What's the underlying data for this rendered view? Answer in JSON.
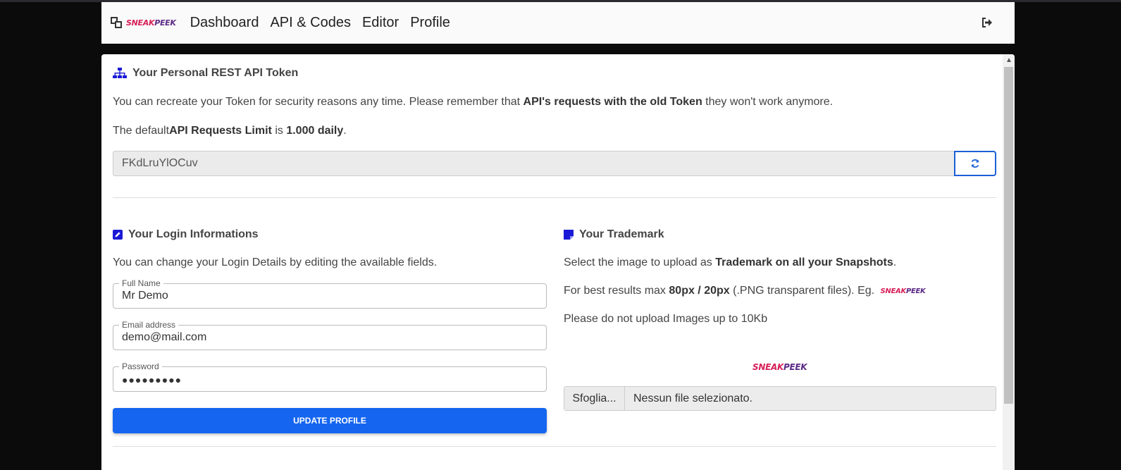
{
  "navbar": {
    "brand_part1": "SNEAK",
    "brand_part2": "PEEK",
    "links": [
      "Dashboard",
      "API & Codes",
      "Editor",
      "Profile"
    ],
    "logout_icon": "sign-out-icon"
  },
  "token_section": {
    "title": "Your Personal REST API Token",
    "desc_pre": "You can recreate your Token for security reasons any time. Please remember that ",
    "desc_bold": "API's requests with the old Token",
    "desc_post": " they won't work anymore.",
    "limit_pre": "The default",
    "limit_bold1": "API Requests Limit",
    "limit_mid": " is ",
    "limit_bold2": "1.000 daily",
    "limit_post": ".",
    "token_value": "FKdLruYlOCuv",
    "refresh_icon": "refresh-icon"
  },
  "login_section": {
    "title": "Your Login Informations",
    "desc": "You can change your Login Details by editing the available fields.",
    "full_name_label": "Full Name",
    "full_name_value": "Mr Demo",
    "email_label": "Email address",
    "email_value": "demo@mail.com",
    "password_label": "Password",
    "password_value": "●●●●●●●●●",
    "update_button": "UPDATE PROFILE"
  },
  "trademark_section": {
    "title": "Your Trademark",
    "desc_pre": "Select the image to upload as ",
    "desc_bold": "Trademark on all your Snapshots",
    "desc_post": ".",
    "size_pre": "For best results max ",
    "size_bold": "80px / 20px",
    "size_post": " (.PNG transparent files). Eg. ",
    "limit_note": "Please do not upload Images up to 10Kb",
    "example_part1": "SNEAK",
    "example_part2": "PEEK",
    "browse_button": "Sfoglia...",
    "file_status": "Nessun file selezionato."
  },
  "colors": {
    "primary": "#1565f0",
    "icon_blue": "#1a1ad6",
    "brand_red": "#d6205a",
    "brand_purple": "#5b2a86"
  }
}
